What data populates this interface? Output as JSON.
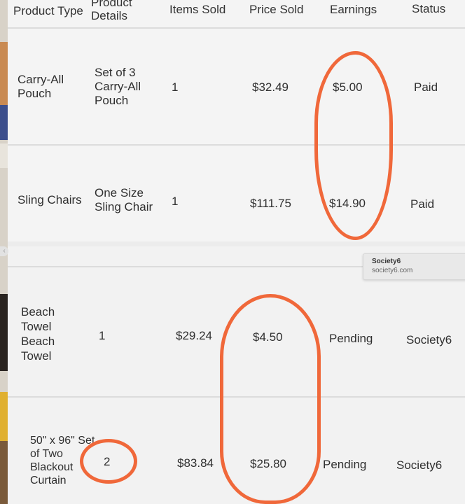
{
  "header": {
    "product_type": "Product Type",
    "product_details": "Product Details",
    "items_sold": "Items Sold",
    "price_sold": "Price Sold",
    "earnings": "Earnings",
    "status": "Status"
  },
  "top_rows": [
    {
      "type": "Carry-All Pouch",
      "details": "Set of 3 Carry-All Pouch",
      "items": "1",
      "price": "$32.49",
      "earnings": "$5.00",
      "status": "Paid"
    },
    {
      "type": "Sling Chairs",
      "details": "One Size Sling Chair",
      "items": "1",
      "price": "$111.75",
      "earnings": "$14.90",
      "status": "Paid"
    }
  ],
  "bottom_rows": [
    {
      "type": "Beach Towel Beach Towel",
      "items": "1",
      "price": "$29.24",
      "earnings": "$4.50",
      "status": "Pending",
      "store": "Society6"
    },
    {
      "type": "50\" x 96\" Set of Two Blackout Curtain",
      "items": "2",
      "price": "$83.84",
      "earnings": "$25.80",
      "status": "Pending",
      "store": "Society6"
    }
  ],
  "tooltip": {
    "title": "Society6",
    "url": "society6.com"
  },
  "colors": {
    "annotation": "#f0683a",
    "panel": "#f4f4f4",
    "rule": "#dcdcdc"
  }
}
